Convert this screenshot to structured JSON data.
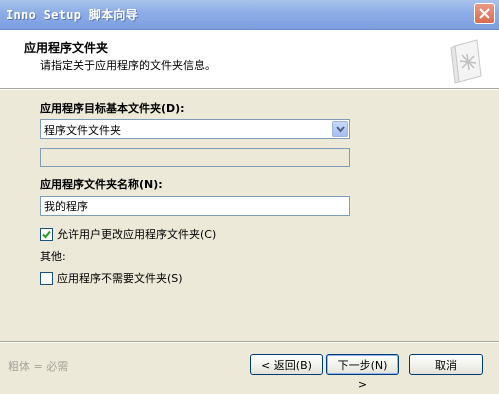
{
  "window": {
    "title": "Inno Setup 脚本向导"
  },
  "header": {
    "title": "应用程序文件夹",
    "subtitle": "请指定关于应用程序的文件夹信息。"
  },
  "form": {
    "dest_label": "应用程序目标基本文件夹(D):",
    "dest_value": "程序文件文件夹",
    "name_label": "应用程序文件夹名称(N):",
    "name_value": "我的程序",
    "allow_change_label": "允许用户更改应用程序文件夹(C)",
    "allow_change_checked": true,
    "other_label": "其他:",
    "no_folder_label": "应用程序不需要文件夹(S)",
    "no_folder_checked": false
  },
  "footer": {
    "note": "粗体 = 必需",
    "back_label": "< 返回(B)",
    "next_label": "下一步(N) >",
    "cancel_label": "取消"
  },
  "colors": {
    "titlebar": "#8cace6",
    "close": "#d86b50",
    "dialog_bg": "#ece9d8",
    "input_border": "#7f9db9"
  }
}
